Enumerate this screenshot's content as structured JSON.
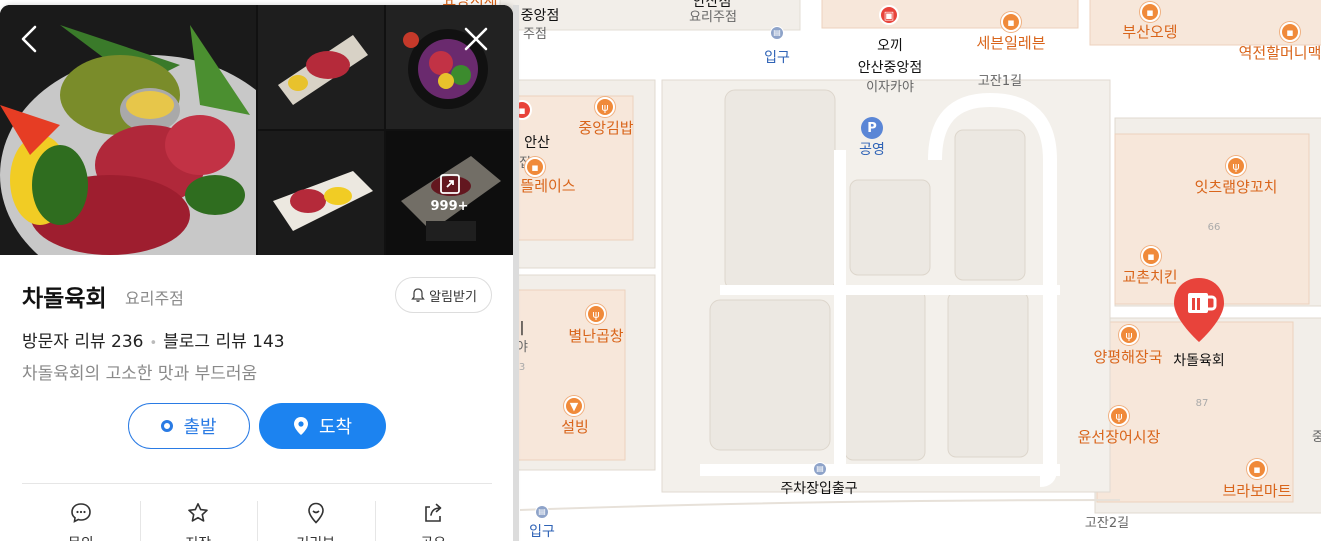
{
  "place": {
    "name": "차돌육회",
    "category": "요리주점",
    "visitor_review_label": "방문자 리뷰",
    "visitor_review_count": "236",
    "blog_review_label": "블로그 리뷰",
    "blog_review_count": "143",
    "tagline": "차돌육회의 고소한 맛과 부드러움",
    "photo_count": "999+"
  },
  "buttons": {
    "alert": "알림받기",
    "depart": "출발",
    "arrive": "도착"
  },
  "actions": [
    {
      "label": "문의",
      "icon": "chat-bubble-icon"
    },
    {
      "label": "저장",
      "icon": "star-icon"
    },
    {
      "label": "거리뷰",
      "icon": "location-pin-icon"
    },
    {
      "label": "공유",
      "icon": "share-icon"
    }
  ],
  "colors": {
    "accent_blue": "#1c83f0",
    "poi_orange": "#f08a3a",
    "pin_red": "#e8433b"
  },
  "map": {
    "top_partial": [
      "요양서재",
      "중앙점",
      "요리주점",
      "주점",
      "안산점"
    ],
    "labels": {
      "okki": "오끼",
      "okki_branch": "안산중앙점",
      "izakaya": "이자카야",
      "seven_eleven": "세븐일레븐",
      "busan_odeng": "부산오뎅",
      "yeokjeon": "역전할머니맥",
      "gojan1": "고잔1길",
      "entrance_top": "입구",
      "parking_label": "공영",
      "joongang_gimbap": "중앙김밥",
      "ansan": "안산",
      "jip": "집",
      "place_partial": "뜰레이스",
      "eats_lamb": "잇츠램양꼬치",
      "num_66": "66",
      "kyochon": "교촌치킨",
      "yangpyeong": "양평해장국",
      "chadol": "차돌육회",
      "num_87": "87",
      "yunseon": "윤선장어시장",
      "bravo": "브라보마트",
      "byeollan": "별난곱창",
      "seolbing": "설빙",
      "parking_exit": "주차장입출구",
      "gojan2": "고잔2길",
      "entrance_bottom": "입구",
      "left_i": "|",
      "left_ya": "야",
      "left_3": "3",
      "right_edge": "중"
    }
  }
}
